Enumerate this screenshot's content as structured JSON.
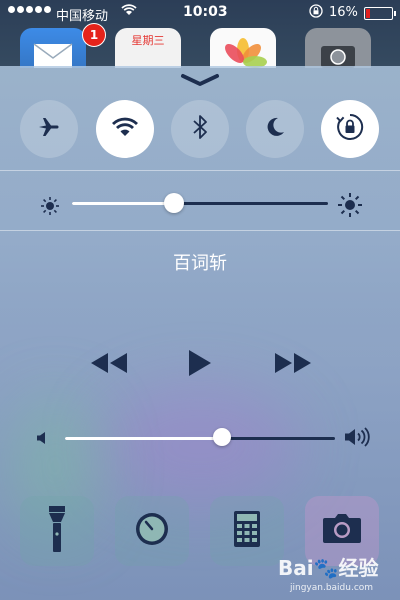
{
  "status_bar": {
    "carrier": "中国移动",
    "time": "10:03",
    "battery_percent": "16%",
    "battery_level": 0.16,
    "signal_dots": 5
  },
  "home_screen": {
    "mail_badge": "1",
    "calendar_label": "星期三"
  },
  "control_center": {
    "toggles": [
      {
        "name": "airplane-mode",
        "icon": "airplane-icon",
        "active": false
      },
      {
        "name": "wifi",
        "icon": "wifi-icon",
        "active": true
      },
      {
        "name": "bluetooth",
        "icon": "bluetooth-icon",
        "active": false
      },
      {
        "name": "do-not-disturb",
        "icon": "moon-icon",
        "active": false
      },
      {
        "name": "rotation-lock",
        "icon": "rotation-lock-icon",
        "active": true
      }
    ],
    "brightness_level": 0.4,
    "now_playing_title": "百词斩",
    "volume_level": 0.58,
    "quick_tools": [
      {
        "name": "flashlight",
        "icon": "flashlight-icon"
      },
      {
        "name": "timer",
        "icon": "timer-icon"
      },
      {
        "name": "calculator",
        "icon": "calculator-icon"
      },
      {
        "name": "camera",
        "icon": "camera-icon"
      }
    ]
  },
  "watermark": {
    "logo_text": "Bai🐾经验",
    "url": "jingyan.baidu.com"
  },
  "colors": {
    "accent_dark": "#1d2e4f",
    "battery_low": "#e02020",
    "badge": "#e5231b"
  }
}
